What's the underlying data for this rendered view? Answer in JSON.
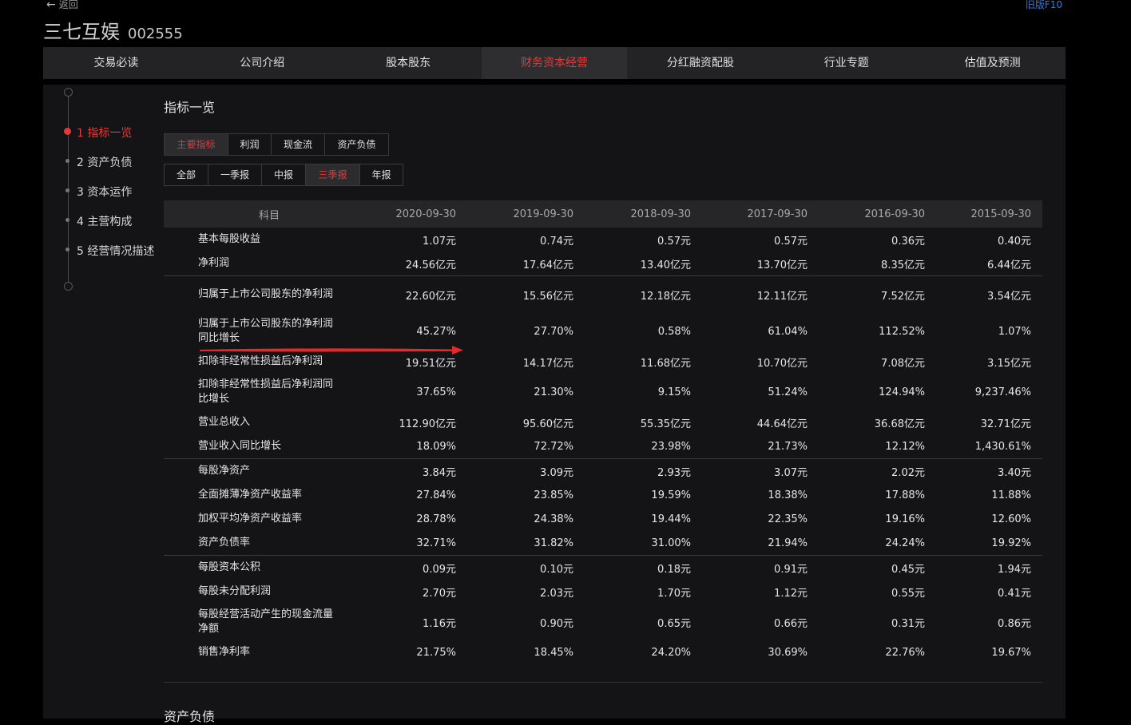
{
  "header": {
    "back_label": "返回",
    "old_version_label": "旧版F10",
    "company_name": "三七互娱",
    "stock_code": "002555"
  },
  "nav": {
    "tabs": [
      {
        "label": "交易必读"
      },
      {
        "label": "公司介绍"
      },
      {
        "label": "股本股东"
      },
      {
        "label": "财务资本经营",
        "active": true
      },
      {
        "label": "分红融资配股"
      },
      {
        "label": "行业专题"
      },
      {
        "label": "估值及预测"
      }
    ]
  },
  "sidebar": {
    "items": [
      {
        "label": "1 指标一览",
        "active": true
      },
      {
        "label": "2 资产负债"
      },
      {
        "label": "3 资本运作"
      },
      {
        "label": "4 主营构成"
      },
      {
        "label": "5 经营情况描述"
      }
    ]
  },
  "main": {
    "section_title": "指标一览",
    "next_section_title": "资产负债",
    "report_tabs": [
      {
        "label": "主要指标",
        "active": true
      },
      {
        "label": "利润"
      },
      {
        "label": "现金流"
      },
      {
        "label": "资产负债"
      }
    ],
    "period_tabs": [
      {
        "label": "全部"
      },
      {
        "label": "一季报"
      },
      {
        "label": "中报"
      },
      {
        "label": "三季报",
        "active": true
      },
      {
        "label": "年报"
      }
    ]
  },
  "table": {
    "subject_header": "科目",
    "columns": [
      "2020-09-30",
      "2019-09-30",
      "2018-09-30",
      "2017-09-30",
      "2016-09-30",
      "2015-09-30"
    ],
    "rows": [
      {
        "label": "基本每股收益",
        "values": [
          "1.07元",
          "0.74元",
          "0.57元",
          "0.57元",
          "0.36元",
          "0.40元"
        ]
      },
      {
        "label": "净利润",
        "values": [
          "24.56亿元",
          "17.64亿元",
          "13.40亿元",
          "13.70亿元",
          "8.35亿元",
          "6.44亿元"
        ]
      },
      {
        "label": "归属于上市公司股东的净利润",
        "values": [
          "22.60亿元",
          "15.56亿元",
          "12.18亿元",
          "12.11亿元",
          "7.52亿元",
          "3.54亿元"
        ]
      },
      {
        "label": "归属于上市公司股东的净利润同比增长",
        "values": [
          "45.27%",
          "27.70%",
          "0.58%",
          "61.04%",
          "112.52%",
          "1.07%"
        ]
      },
      {
        "label": "扣除非经常性损益后净利润",
        "values": [
          "19.51亿元",
          "14.17亿元",
          "11.68亿元",
          "10.70亿元",
          "7.08亿元",
          "3.15亿元"
        ]
      },
      {
        "label": "扣除非经常性损益后净利润同比增长",
        "values": [
          "37.65%",
          "21.30%",
          "9.15%",
          "51.24%",
          "124.94%",
          "9,237.46%"
        ]
      },
      {
        "label": "营业总收入",
        "values": [
          "112.90亿元",
          "95.60亿元",
          "55.35亿元",
          "44.64亿元",
          "36.68亿元",
          "32.71亿元"
        ]
      },
      {
        "label": "营业收入同比增长",
        "values": [
          "18.09%",
          "72.72%",
          "23.98%",
          "21.73%",
          "12.12%",
          "1,430.61%"
        ]
      },
      {
        "label": "每股净资产",
        "values": [
          "3.84元",
          "3.09元",
          "2.93元",
          "3.07元",
          "2.02元",
          "3.40元"
        ]
      },
      {
        "label": "全面摊薄净资产收益率",
        "values": [
          "27.84%",
          "23.85%",
          "19.59%",
          "18.38%",
          "17.88%",
          "11.88%"
        ]
      },
      {
        "label": "加权平均净资产收益率",
        "values": [
          "28.78%",
          "24.38%",
          "19.44%",
          "22.35%",
          "19.16%",
          "12.60%"
        ]
      },
      {
        "label": "资产负债率",
        "values": [
          "32.71%",
          "31.82%",
          "31.00%",
          "21.94%",
          "24.24%",
          "19.92%"
        ]
      },
      {
        "label": "每股资本公积",
        "values": [
          "0.09元",
          "0.10元",
          "0.18元",
          "0.91元",
          "0.45元",
          "1.94元"
        ]
      },
      {
        "label": "每股未分配利润",
        "values": [
          "2.70元",
          "2.03元",
          "1.70元",
          "1.12元",
          "0.55元",
          "0.41元"
        ]
      },
      {
        "label": "每股经营活动产生的现金流量净额",
        "values": [
          "1.16元",
          "0.90元",
          "0.65元",
          "0.66元",
          "0.31元",
          "0.86元"
        ]
      },
      {
        "label": "销售净利率",
        "values": [
          "21.75%",
          "18.45%",
          "24.20%",
          "30.69%",
          "22.76%",
          "19.67%"
        ]
      }
    ]
  },
  "colors": {
    "accent_red": "#e03b3b",
    "link_blue": "#2f7cd8",
    "background": "#000000",
    "panel": "#141416"
  }
}
